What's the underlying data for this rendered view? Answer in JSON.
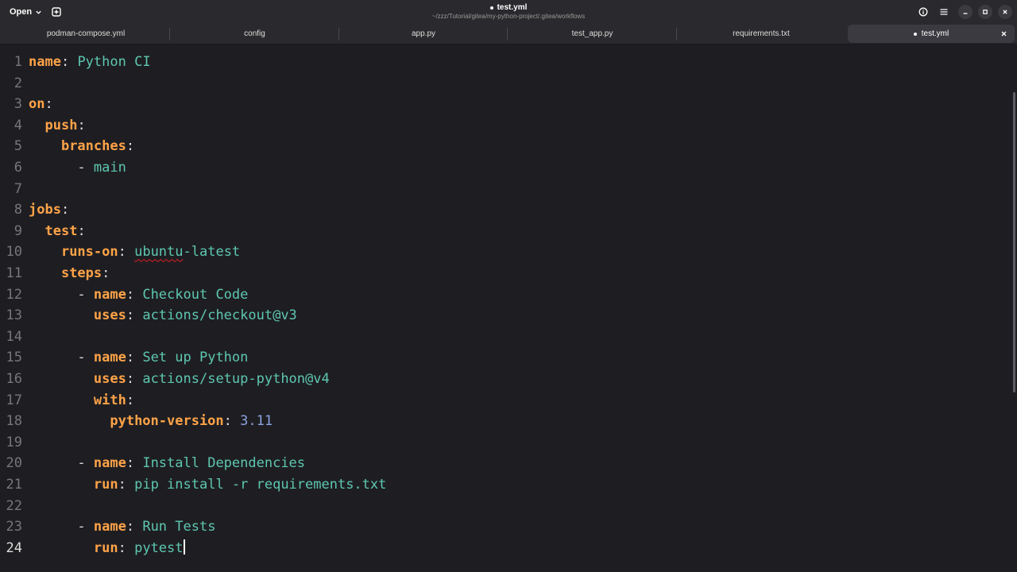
{
  "header": {
    "open_label": "Open",
    "title": "test.yml",
    "subtitle": "~/zzz/Tutorial/gitea/my-python-project/.gitea/workflows",
    "icons": [
      "chevron-down-icon",
      "new-tab-icon",
      "document-info-icon",
      "hamburger-menu-icon",
      "minimize-icon",
      "maximize-icon",
      "close-icon"
    ]
  },
  "tabs": [
    {
      "label": "podman-compose.yml"
    },
    {
      "label": "config"
    },
    {
      "label": "app.py"
    },
    {
      "label": "test_app.py"
    },
    {
      "label": "requirements.txt"
    },
    {
      "label": "test.yml",
      "active": true,
      "modified": true
    }
  ],
  "editor": {
    "line_numbers": [
      "1",
      "2",
      "3",
      "4",
      "5",
      "6",
      "7",
      "8",
      "9",
      "10",
      "11",
      "12",
      "13",
      "14",
      "15",
      "16",
      "17",
      "18",
      "19",
      "20",
      "21",
      "22",
      "23",
      "24"
    ],
    "current_line": "24",
    "lines": [
      {
        "indent": "",
        "key": "name",
        "colon": ": ",
        "value": "Python CI"
      },
      {},
      {
        "indent": "",
        "key": "on",
        "colon": ":"
      },
      {
        "indent": "  ",
        "key": "push",
        "colon": ":"
      },
      {
        "indent": "    ",
        "key": "branches",
        "colon": ":"
      },
      {
        "indent": "      - ",
        "value": "main"
      },
      {},
      {
        "indent": "",
        "key": "jobs",
        "colon": ":"
      },
      {
        "indent": "  ",
        "key": "test",
        "colon": ":"
      },
      {
        "indent": "    ",
        "key": "runs-on",
        "colon": ": ",
        "value": "ubuntu",
        "value_rest": "-latest"
      },
      {
        "indent": "    ",
        "key": "steps",
        "colon": ":"
      },
      {
        "indent": "      - ",
        "key": "name",
        "colon": ": ",
        "value": "Checkout Code"
      },
      {
        "indent": "        ",
        "key": "uses",
        "colon": ": ",
        "value": "actions/checkout@v3"
      },
      {},
      {
        "indent": "      - ",
        "key": "name",
        "colon": ": ",
        "value": "Set up Python"
      },
      {
        "indent": "        ",
        "key": "uses",
        "colon": ": ",
        "value": "actions/setup-python@v4"
      },
      {
        "indent": "        ",
        "key": "with",
        "colon": ":"
      },
      {
        "indent": "          ",
        "key": "python-version",
        "colon": ": ",
        "number": "3.11"
      },
      {},
      {
        "indent": "      - ",
        "key": "name",
        "colon": ": ",
        "value": "Install Dependencies"
      },
      {
        "indent": "        ",
        "key": "run",
        "colon": ": ",
        "value": "pip install -r requirements.txt"
      },
      {},
      {
        "indent": "      - ",
        "key": "name",
        "colon": ": ",
        "value": "Run Tests"
      },
      {
        "indent": "        ",
        "key": "run",
        "colon": ": ",
        "value": "pytest"
      }
    ]
  },
  "colors": {
    "background": "#1e1e22",
    "key": "#ffa348",
    "string": "#5ec7b0",
    "number": "#8ea2e0",
    "spell_error": "#e01b24"
  }
}
